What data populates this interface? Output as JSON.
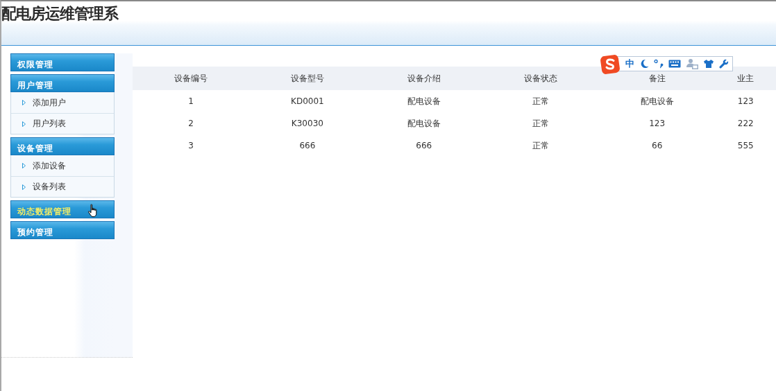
{
  "header": {
    "title": "配电房运维管理系"
  },
  "sidebar": {
    "groups": [
      {
        "label": "权限管理",
        "hovered": false
      },
      {
        "label": "用户管理",
        "hovered": false,
        "items": [
          {
            "label": "添加用户"
          },
          {
            "label": "用户列表"
          }
        ]
      },
      {
        "label": "设备管理",
        "hovered": false,
        "items": [
          {
            "label": "添加设备"
          },
          {
            "label": "设备列表"
          }
        ]
      },
      {
        "label": "动态数据管理",
        "hovered": true
      },
      {
        "label": "预约管理",
        "hovered": false
      }
    ]
  },
  "ime_toolbar": {
    "mode": "中"
  },
  "table": {
    "columns": [
      "设备编号",
      "设备型号",
      "设备介绍",
      "设备状态",
      "备注",
      "业主"
    ],
    "rows": [
      [
        "1",
        "KD0001",
        "配电设备",
        "正常",
        "配电设备",
        "123"
      ],
      [
        "2",
        "K30030",
        "配电设备",
        "正常",
        "123",
        "222"
      ],
      [
        "3",
        "666",
        "666",
        "正常",
        "66",
        "555"
      ]
    ]
  }
}
